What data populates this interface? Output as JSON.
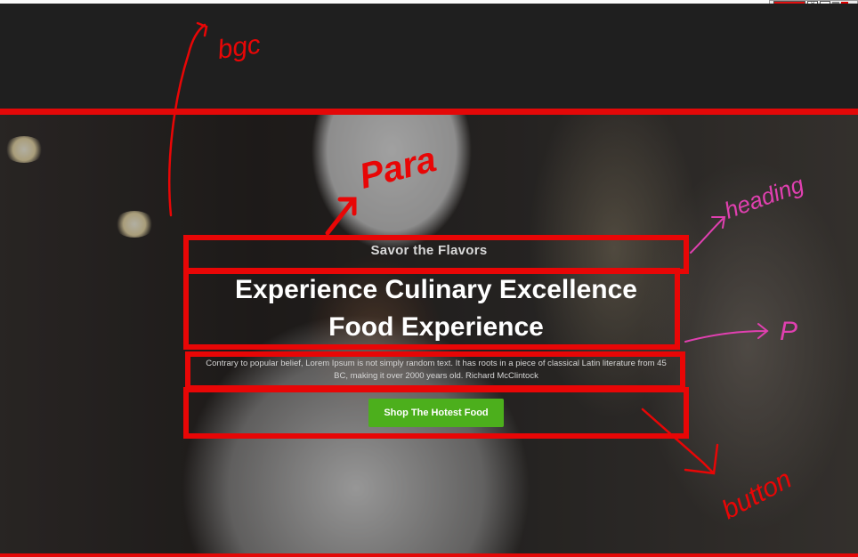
{
  "hero": {
    "eyebrow": "Savor the Flavors",
    "title_line1": "Experience Culinary Excellence",
    "title_line2": "Food Experience",
    "paragraph": "Contrary to popular belief, Lorem Ipsum is not simply random text. It has roots in a piece of classical Latin literature from 45 BC, making it over 2000 years old. Richard McClintock",
    "cta_label": "Shop The Hotest Food"
  },
  "annotations": {
    "bg_note": "bgc",
    "para_note": "Para",
    "heading_note": "heading",
    "p_note": "P",
    "button_note": "button"
  },
  "colors": {
    "annotation_red": "#e80606",
    "annotation_pink": "#e040b0",
    "cta_green": "#4caf1c",
    "header_bg": "#1f1f1f"
  }
}
